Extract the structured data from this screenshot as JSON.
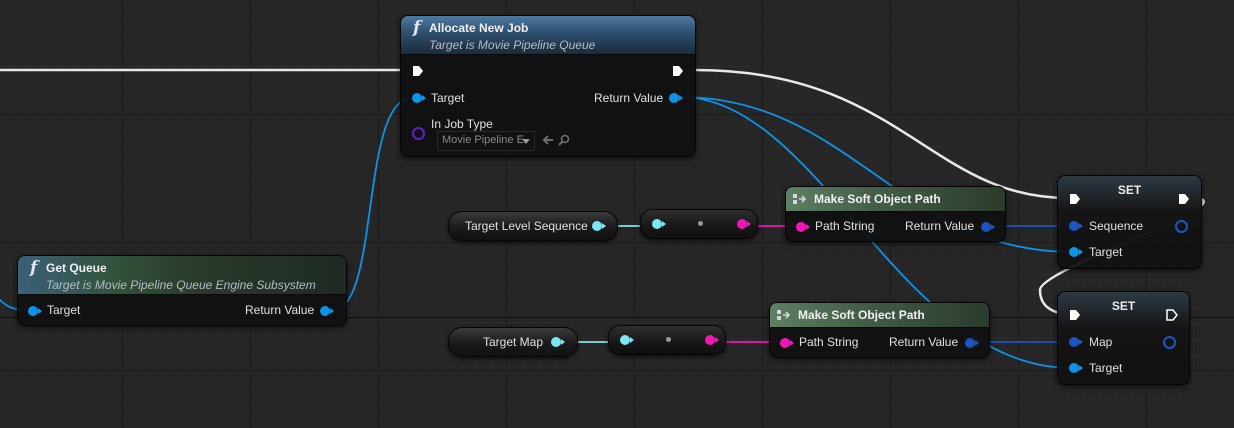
{
  "nodes": {
    "allocate": {
      "title": "Allocate New Job",
      "subtitle": "Target is Movie Pipeline Queue",
      "target_label": "Target",
      "return_label": "Return Value",
      "job_type_label": "In Job Type",
      "job_type_value": "Movie Pipeline E"
    },
    "get_queue": {
      "title": "Get Queue",
      "subtitle": "Target is Movie Pipeline Queue Engine Subsystem",
      "target_label": "Target",
      "return_label": "Return Value"
    },
    "make_path_1": {
      "title": "Make Soft Object Path",
      "path_label": "Path String",
      "return_label": "Return Value"
    },
    "make_path_2": {
      "title": "Make Soft Object Path",
      "path_label": "Path String",
      "return_label": "Return Value"
    },
    "set_1": {
      "title": "SET",
      "field_label": "Sequence",
      "target_label": "Target"
    },
    "set_2": {
      "title": "SET",
      "field_label": "Map",
      "target_label": "Target"
    },
    "var_sequence": {
      "label": "Target Level Sequence"
    },
    "var_map": {
      "label": "Target Map"
    }
  },
  "icons": [
    "function-icon",
    "make-struct-icon",
    "exec-pin-icon",
    "back-arrow-icon",
    "magnifier-icon",
    "dropdown-caret-icon"
  ],
  "colors": {
    "object_pin": "#0d93e8",
    "soft_ref_pin": "#7de7f0",
    "string_pin": "#f016b8",
    "struct_pin": "#1c54c4",
    "enum_pin": "#6220c8",
    "exec_wire": "#ffffff",
    "function_header": "#4d7aa2",
    "pure_header": "#5d7f62"
  }
}
